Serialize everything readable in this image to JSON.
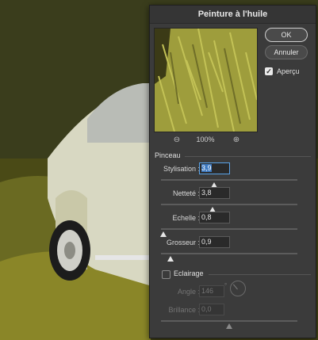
{
  "dialog": {
    "title": "Peinture à l'huile",
    "ok_label": "OK",
    "cancel_label": "Annuler",
    "preview_label": "Aperçu",
    "preview_checked": true,
    "zoom": "100%"
  },
  "brush": {
    "header": "Pinceau",
    "params": [
      {
        "label": "Stylisation :",
        "value": "3,9",
        "level": 0.39
      },
      {
        "label": "Netteté :",
        "value": "3,8",
        "level": 0.38
      },
      {
        "label": "Echelle :",
        "value": "0,8",
        "level": 0.02
      },
      {
        "label": "Grosseur :",
        "value": "0,9",
        "level": 0.07
      }
    ]
  },
  "lighting": {
    "header": "Eclairage",
    "checked": false,
    "angle_label": "Angle :",
    "angle_value": "146",
    "angle_unit": "°",
    "brilliance_label": "Brillance :",
    "brilliance_value": "0,0",
    "brilliance_level": 0.5
  },
  "colors": {
    "accent": "#3d79c0",
    "panel": "#3b3b3b",
    "field": "#2a2a2a"
  }
}
